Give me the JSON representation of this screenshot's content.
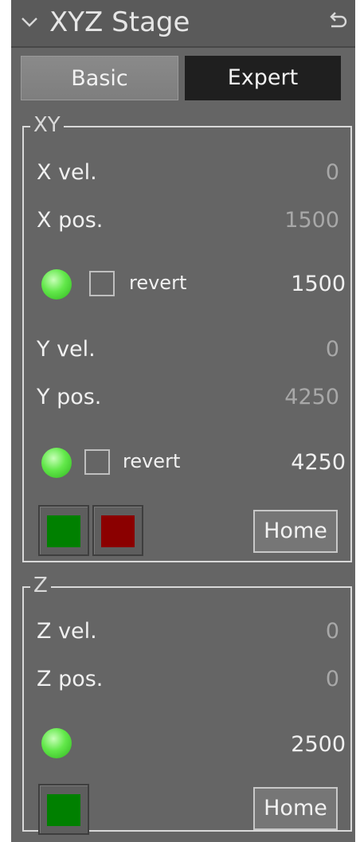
{
  "header": {
    "title": "XYZ Stage",
    "collapse_icon": "chevron-down-icon",
    "reset_icon": "undo-icon"
  },
  "tabs": [
    {
      "label": "Basic",
      "active": true
    },
    {
      "label": "Expert",
      "active": false
    }
  ],
  "xy": {
    "group_title": "XY",
    "x_vel_label": "X vel.",
    "x_vel_value": "0",
    "x_pos_label": "X pos.",
    "x_pos_value": "1500",
    "x_revert_label": "revert",
    "x_target": "1500",
    "y_vel_label": "Y vel.",
    "y_vel_value": "0",
    "y_pos_label": "Y pos.",
    "y_pos_value": "4250",
    "y_revert_label": "revert",
    "y_target": "4250",
    "home_label": "Home"
  },
  "z": {
    "group_title": "Z",
    "z_vel_label": "Z vel.",
    "z_vel_value": "0",
    "z_pos_label": "Z pos.",
    "z_pos_value": "0",
    "z_target": "2500",
    "home_label": "Home"
  },
  "colors": {
    "panel_bg": "#656565",
    "led_green": "#62e84a",
    "start_green": "#008000",
    "stop_red": "#8b0000",
    "expert_tab_bg": "#1f1f1f"
  }
}
